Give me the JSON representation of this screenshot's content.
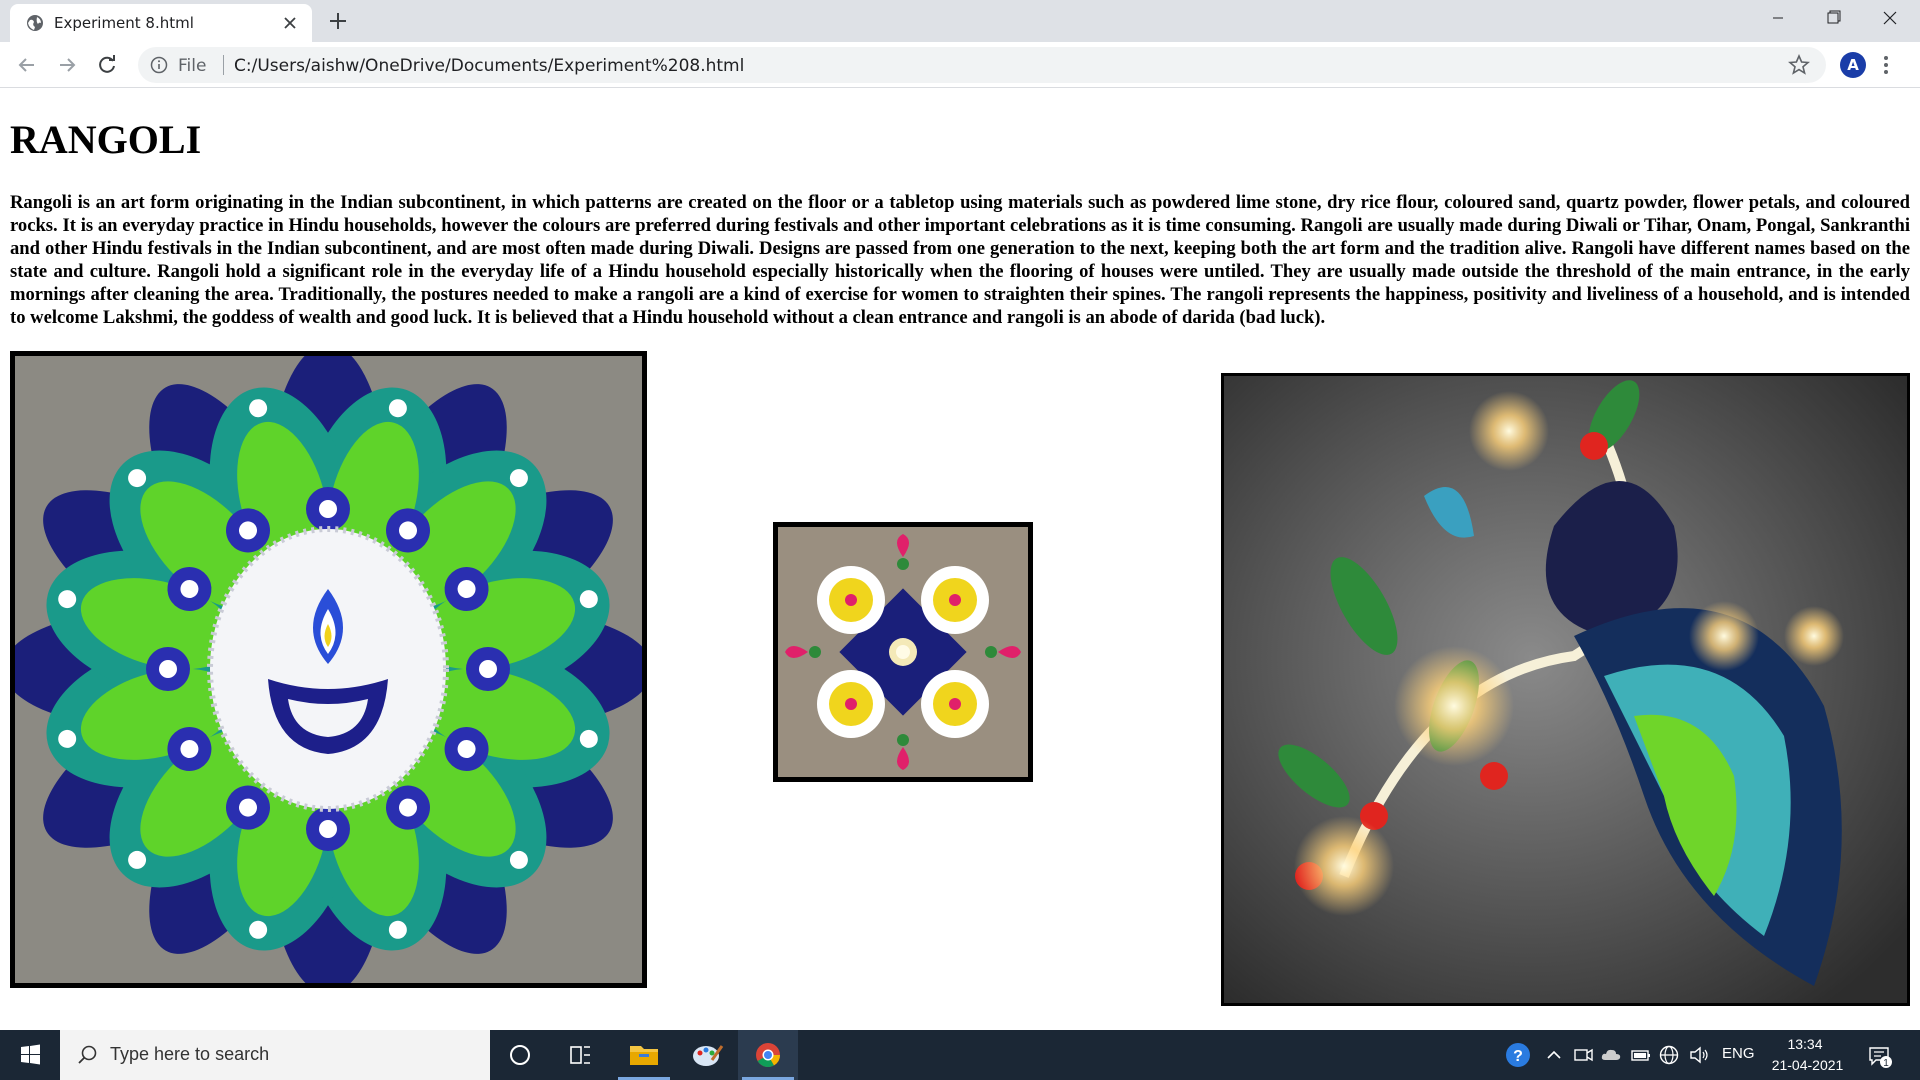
{
  "browser": {
    "tab_title": "Experiment 8.html",
    "scheme_label": "File",
    "url": "C:/Users/aishw/OneDrive/Documents/Experiment%208.html",
    "profile_initial": "A"
  },
  "page": {
    "heading": "RANGOLI",
    "paragraph": "Rangoli is an art form originating in the Indian subcontinent, in which patterns are created on the floor or a tabletop using materials such as powdered lime stone, dry rice flour, coloured sand, quartz powder, flower petals, and coloured rocks. It is an everyday practice in Hindu households, however the colours are preferred during festivals and other important celebrations as it is time consuming. Rangoli are usually made during Diwali or Tihar, Onam, Pongal, Sankranthi and other Hindu festivals in the Indian subcontinent, and are most often made during Diwali. Designs are passed from one generation to the next, keeping both the art form and the tradition alive. Rangoli have different names based on the state and culture. Rangoli hold a significant role in the everyday life of a Hindu household especially historically when the flooring of houses were untiled. They are usually made outside the threshold of the main entrance, in the early mornings after cleaning the area. Traditionally, the postures needed to make a rangoli are a kind of exercise for women to straighten their spines. The rangoli represents the happiness, positivity and liveliness of a household, and is intended to welcome Lakshmi, the goddess of wealth and good luck. It is believed that a Hindu household without a clean entrance and rangoli is an abode of darida (bad luck)."
  },
  "taskbar": {
    "search_placeholder": "Type here to search",
    "language": "ENG",
    "time": "13:34",
    "date": "21-04-2021",
    "notification_count": "1"
  },
  "icons": [
    "globe-icon",
    "close-icon",
    "plus-icon",
    "minimize-icon",
    "maximize-icon",
    "back-icon",
    "forward-icon",
    "reload-icon",
    "info-icon",
    "star-icon",
    "menu-icon",
    "windows-icon",
    "search-icon",
    "cortana-icon",
    "task-view-icon",
    "file-explorer-icon",
    "paint-icon",
    "chrome-icon",
    "help-icon",
    "chevron-up-icon",
    "network-icon",
    "speaker-icon",
    "battery-icon",
    "notification-icon"
  ]
}
